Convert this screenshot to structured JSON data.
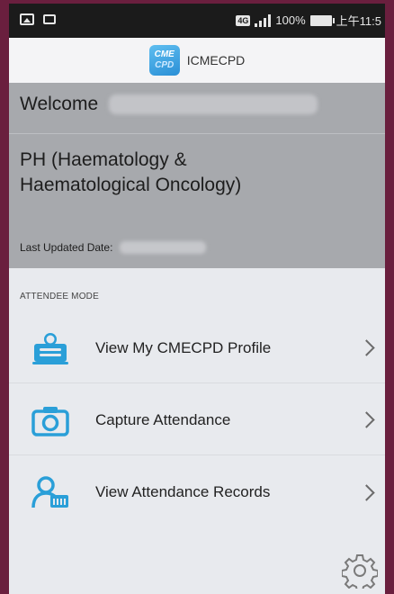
{
  "status_bar": {
    "network": "4G",
    "battery": "100%",
    "time": "上午11:5"
  },
  "header": {
    "logo_line1": "CME",
    "logo_line2": "CPD",
    "title": "ICMECPD"
  },
  "welcome": {
    "greeting": "Welcome",
    "specialty": "PH (Haematology & Haematological Oncology)",
    "last_updated_label": "Last Updated Date:"
  },
  "attendee": {
    "section_label": "ATTENDEE MODE",
    "items": [
      {
        "label": "View My CMECPD Profile",
        "icon": "profile-card-icon"
      },
      {
        "label": "Capture Attendance",
        "icon": "camera-icon"
      },
      {
        "label": "View Attendance Records",
        "icon": "attendance-records-icon"
      }
    ]
  },
  "colors": {
    "accent": "#2a9fd8",
    "frame": "#6a1f3e",
    "panel": "#a7a9ad",
    "background": "#e8eaee"
  }
}
